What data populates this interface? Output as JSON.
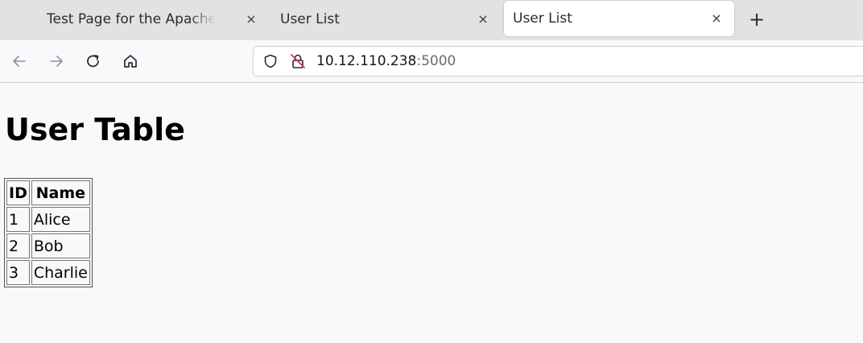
{
  "browser": {
    "tabs": [
      {
        "title": "Test Page for the Apache HTTP Server",
        "active": false
      },
      {
        "title": "User List",
        "active": false
      },
      {
        "title": "User List",
        "active": true
      }
    ],
    "new_tab_label": "+",
    "close_glyph": "×",
    "url": {
      "host": "10.12.110.238",
      "port": ":5000"
    }
  },
  "page": {
    "title": "User Table",
    "table": {
      "headers": [
        "ID",
        "Name"
      ],
      "rows": [
        [
          "1",
          "Alice"
        ],
        [
          "2",
          "Bob"
        ],
        [
          "3",
          "Charlie"
        ]
      ]
    }
  },
  "colors": {
    "tab_strip": "#e3e2e0",
    "active_tab": "#ffffff",
    "page_bg": "#f9faf8",
    "insecure_lock": "#e22850"
  },
  "icons": [
    "back-arrow-icon",
    "forward-arrow-icon",
    "reload-icon",
    "home-icon",
    "shield-icon",
    "insecure-lock-icon",
    "close-icon",
    "plus-icon"
  ]
}
